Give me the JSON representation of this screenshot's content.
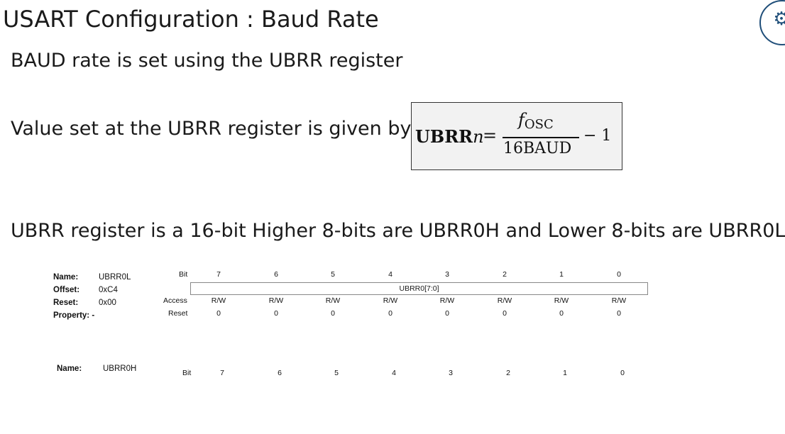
{
  "slide": {
    "title": "USART Configuration : Baud Rate",
    "line1": "BAUD rate is set using the UBRR register",
    "line2": "Value set at the UBRR register is given by",
    "line3": "UBRR register is a 16-bit Higher 8-bits are UBRR0H and Lower 8-bits are UBRR0L",
    "logo_icon": "gear-icon",
    "accent_color": "#1f4e79"
  },
  "formula": {
    "lhs_bold": "UBRR",
    "lhs_italic": "n",
    "equals": "=",
    "numerator_f": "f",
    "numerator_sub": "OSC",
    "denominator": "16BAUD",
    "minus_one": "− 1"
  },
  "register_low": {
    "name_label": "Name:",
    "name_value": "UBRR0L",
    "offset_label": "Offset:",
    "offset_value": "0xC4",
    "reset_label": "Reset:",
    "reset_value": "0x00",
    "property_label": "Property: -",
    "bit_label": "Bit",
    "bits": [
      "7",
      "6",
      "5",
      "4",
      "3",
      "2",
      "1",
      "0"
    ],
    "field": "UBRR0[7:0]",
    "access_label": "Access",
    "access": [
      "R/W",
      "R/W",
      "R/W",
      "R/W",
      "R/W",
      "R/W",
      "R/W",
      "R/W"
    ],
    "reset_row_label": "Reset",
    "reset_bits": [
      "0",
      "0",
      "0",
      "0",
      "0",
      "0",
      "0",
      "0"
    ]
  },
  "register_high": {
    "name_label": "Name:",
    "name_value": "UBRR0H",
    "bit_label": "Bit",
    "bits": [
      "7",
      "6",
      "5",
      "4",
      "3",
      "2",
      "1",
      "0"
    ]
  }
}
